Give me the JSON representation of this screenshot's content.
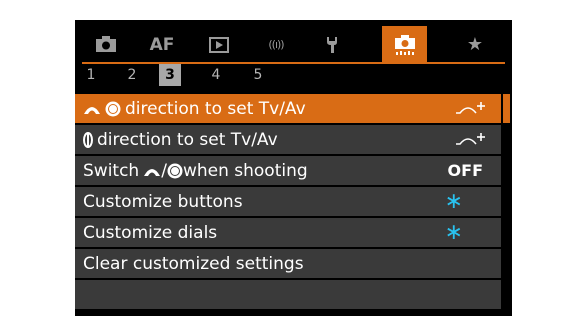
{
  "tabs": [
    {
      "id": "shooting",
      "icon": "camera-icon",
      "label": ""
    },
    {
      "id": "af",
      "icon": "",
      "label": "AF"
    },
    {
      "id": "playback",
      "icon": "playback-icon",
      "label": ""
    },
    {
      "id": "wireless",
      "icon": "wireless-icon",
      "label": "((ı))"
    },
    {
      "id": "setup",
      "icon": "wrench-icon",
      "label": ""
    },
    {
      "id": "custom",
      "icon": "custom-camera-icon",
      "label": "",
      "active": true
    },
    {
      "id": "mymenu",
      "icon": "star-icon",
      "label": "★"
    }
  ],
  "pages": [
    "1",
    "2",
    "3",
    "4",
    "5"
  ],
  "active_page": "3",
  "menu": {
    "items": [
      {
        "label": " direction to set Tv/Av",
        "value": "curve-plus",
        "selected": true
      },
      {
        "label": " direction to set Tv/Av",
        "value": "curve-plus"
      },
      {
        "label": "Switch ",
        "label_mid": "/",
        "label_end": " when shooting",
        "value": "OFF"
      },
      {
        "label": "Customize buttons",
        "value": "∗"
      },
      {
        "label": "Customize dials",
        "value": "∗"
      },
      {
        "label": "Clear customized settings",
        "value": ""
      },
      {
        "label": "",
        "value": ""
      }
    ]
  },
  "colors": {
    "accent": "#d96c15",
    "row_bg": "#3a3a3a",
    "star": "#29c3f0"
  }
}
